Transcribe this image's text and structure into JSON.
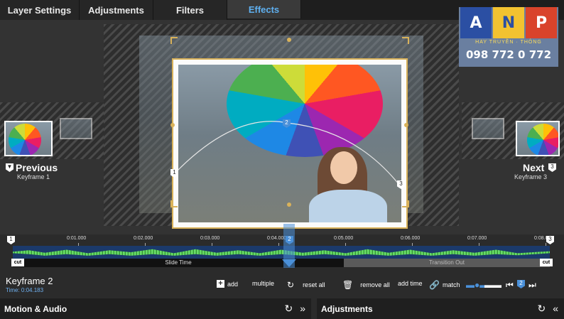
{
  "tabs": [
    {
      "label": "Layer Settings"
    },
    {
      "label": "Adjustments"
    },
    {
      "label": "Filters"
    },
    {
      "label": "Effects",
      "active": true
    }
  ],
  "preview": {
    "previous_label": "Previous",
    "previous_keyframe": "Keyframe 1",
    "next_label": "Next",
    "next_keyframe": "Keyframe 3",
    "markers": [
      "1",
      "2",
      "3"
    ]
  },
  "logo": {
    "letters": [
      "A",
      "N",
      "P"
    ],
    "tagline": "HAY TRUYỀN · THÔNG",
    "phone": "098 772 0 772",
    "colors": [
      "#2b4fa3",
      "#f2c230",
      "#d9432b"
    ]
  },
  "timeline": {
    "ruler": [
      "0:01.000",
      "0:02.000",
      "0:03.000",
      "0:04.000",
      "0:05.000",
      "0:06.000",
      "0:07.000",
      "0:08.0"
    ],
    "start_marker": "1",
    "playhead_marker": "2",
    "end_marker": "3",
    "slide_time_label": "Slide Time",
    "transition_out_label": "Transition Out",
    "cut_label": "cut",
    "waveform_color": "#5bd35b"
  },
  "keyframe_bar": {
    "title": "Keyframe 2",
    "time": "Time: 0:04.183",
    "add": "add",
    "multiple": "multiple",
    "reset_all": "reset all",
    "remove_all": "remove all",
    "add_time": "add time",
    "match": "match",
    "current_badge": "2"
  },
  "panels": {
    "left": "Motion & Audio",
    "right": "Adjustments"
  },
  "accent_color": "#5fb0f0"
}
